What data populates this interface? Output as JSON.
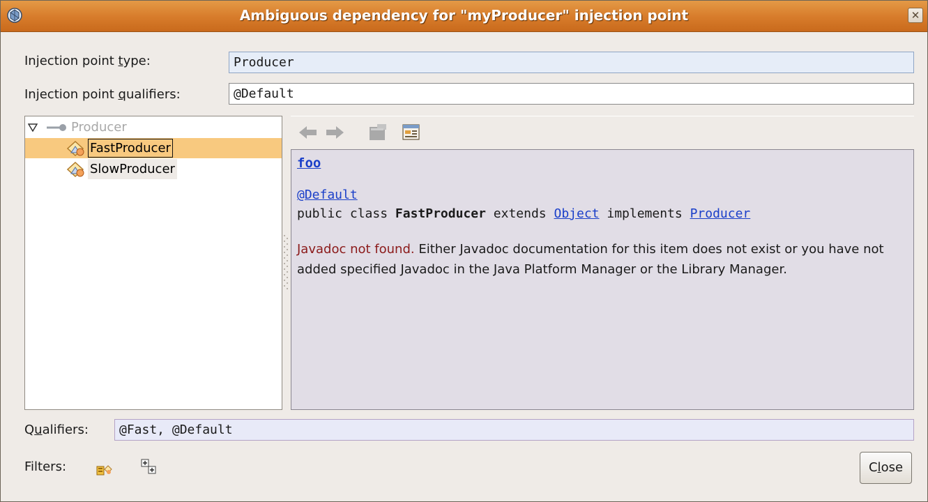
{
  "window": {
    "title": "Ambiguous dependency for \"myProducer\" injection point",
    "close_glyph": "✕"
  },
  "injection_point_type": {
    "label_pre": "Injection point ",
    "label_accel": "t",
    "label_post": "ype:",
    "value": "Producer"
  },
  "injection_point_qualifiers": {
    "label_pre": "Injection point ",
    "label_accel": "q",
    "label_post": "ualifiers:",
    "value": "@Default"
  },
  "tree": {
    "root": {
      "label": "Producer",
      "icon": "interface-icon",
      "expander": "triangle-down"
    },
    "items": [
      {
        "label": "FastProducer",
        "icon": "class-icon",
        "selected": true
      },
      {
        "label": "SlowProducer",
        "icon": "class-icon",
        "selected": false
      }
    ]
  },
  "doc_toolbar": {
    "buttons": [
      {
        "icon": "back-arrow-icon",
        "enabled": false
      },
      {
        "icon": "forward-arrow-icon",
        "enabled": false
      },
      {
        "icon": "goto-source-icon",
        "enabled": false
      },
      {
        "icon": "open-browser-icon",
        "enabled": true
      }
    ]
  },
  "javadoc": {
    "package_link": "foo",
    "annotation_link": "@Default",
    "decl_prefix": "public class ",
    "decl_class": "FastProducer",
    "decl_extends": " extends ",
    "decl_super_link": "Object",
    "decl_implements": " implements ",
    "decl_iface_link": "Producer",
    "not_found": "Javadoc not found.",
    "message": " Either Javadoc documentation for this item does not exist or you have not added specified Javadoc in the Java Platform Manager or the Library Manager."
  },
  "qualifiers": {
    "label_pre": "Q",
    "label_accel": "u",
    "label_post": "alifiers:",
    "value": "@Fast, @Default"
  },
  "filters": {
    "label": "Filters:",
    "buttons": [
      {
        "icon": "filter-classes-icon"
      },
      {
        "icon": "expand-all-icon"
      }
    ]
  },
  "close_button": {
    "label_pre": "C",
    "label_accel": "l",
    "label_post": "ose"
  },
  "colors": {
    "titlebar": "#d87d2c",
    "selection": "#f8c97f",
    "link": "#1a3fc9",
    "error": "#8b1a1a"
  }
}
